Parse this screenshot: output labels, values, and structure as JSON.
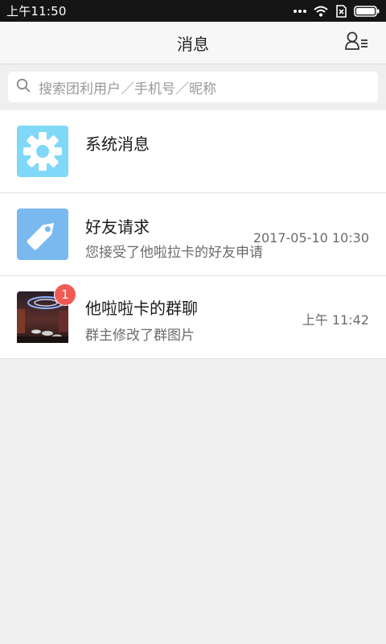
{
  "status_bar": {
    "time": "上午11:50",
    "icons": [
      "more-dots-icon",
      "wifi-icon",
      "no-sim-icon",
      "battery-icon"
    ]
  },
  "header": {
    "title": "消息",
    "right_icon": "contacts-icon"
  },
  "search": {
    "placeholder": "搜索团利用户／手机号／昵称"
  },
  "messages": [
    {
      "name": "系统消息",
      "preview": "",
      "time": "",
      "icon": "gear-icon",
      "color": "#7fd8f8"
    },
    {
      "name": "好友请求",
      "preview": "您接受了他啦拉卡的好友申请",
      "time": "2017-05-10 10:30",
      "icon": "tag-icon",
      "color": "#7ab9f0"
    },
    {
      "name": "他啦啦卡的群聊",
      "preview": "群主修改了群图片",
      "time": "上午 11:42",
      "icon": "group-photo",
      "badge": "1",
      "badge_color": "#f05a54"
    }
  ]
}
